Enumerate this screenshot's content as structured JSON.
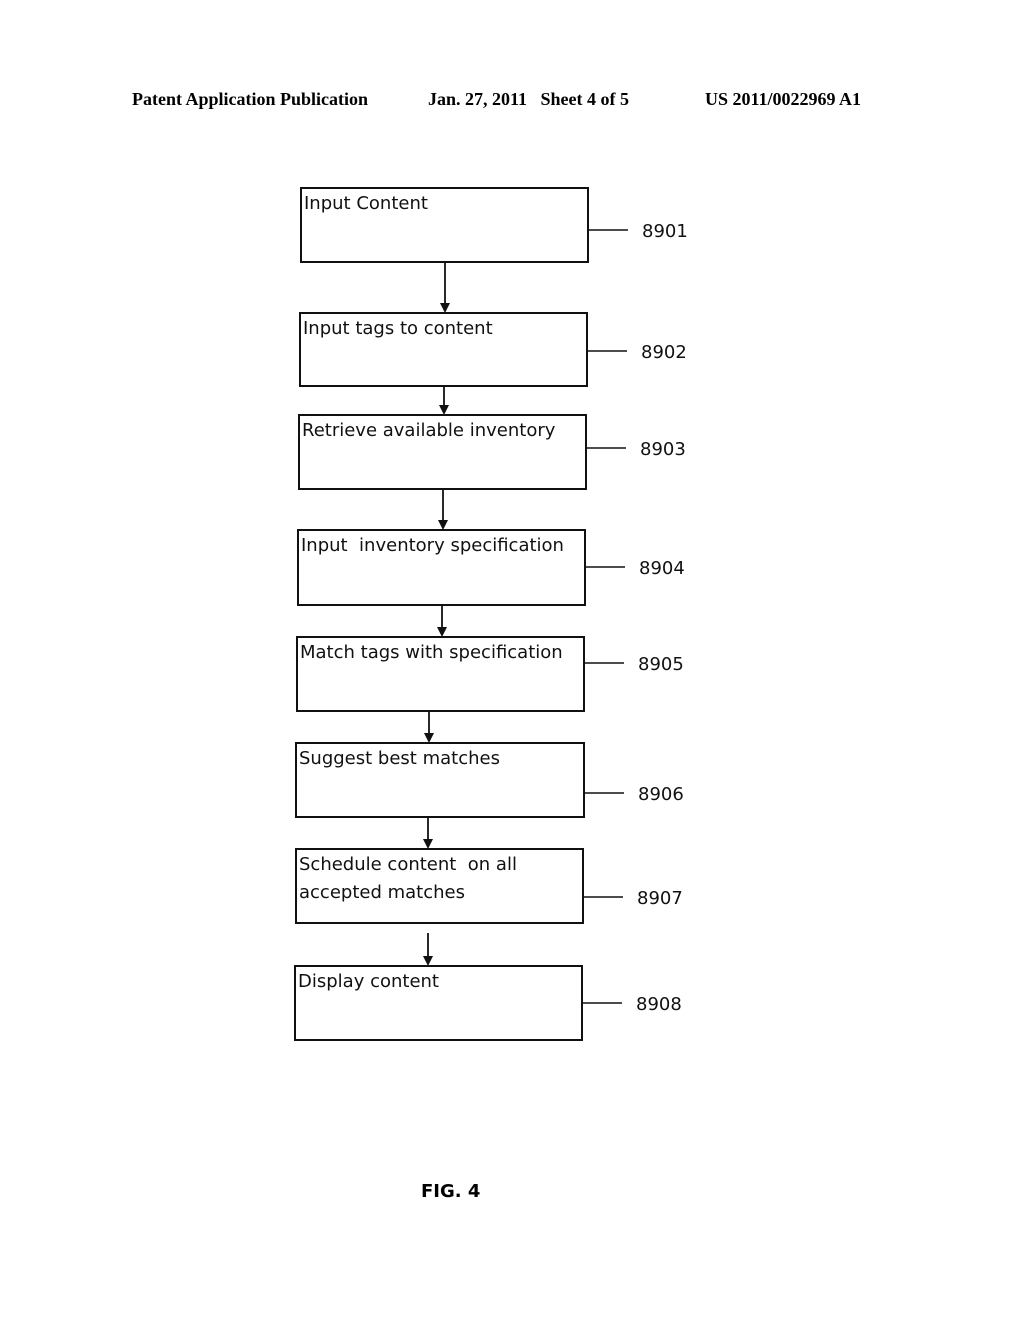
{
  "header": {
    "publication": "Patent Application Publication",
    "date_sheet": "Jan. 27, 2011   Sheet 4 of 5",
    "number": "US 2011/0022969 A1"
  },
  "flowchart": {
    "steps": [
      {
        "ref": "8901",
        "lines": [
          "Input Content"
        ]
      },
      {
        "ref": "8902",
        "lines": [
          "Input tags to content"
        ]
      },
      {
        "ref": "8903",
        "lines": [
          "Retrieve available inventory"
        ]
      },
      {
        "ref": "8904",
        "lines": [
          "Input  inventory specification"
        ]
      },
      {
        "ref": "8905",
        "lines": [
          "Match tags with specification"
        ]
      },
      {
        "ref": "8906",
        "lines": [
          "Suggest best matches"
        ]
      },
      {
        "ref": "8907",
        "lines": [
          "Schedule content  on all",
          "accepted matches"
        ]
      },
      {
        "ref": "8908",
        "lines": [
          "Display content"
        ]
      }
    ]
  },
  "figure_label": "FIG. 4"
}
